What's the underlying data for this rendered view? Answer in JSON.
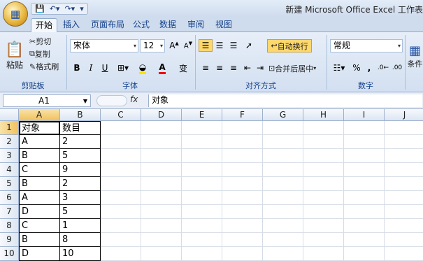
{
  "window": {
    "title": "新建 Microsoft Office Excel 工作表"
  },
  "qat": {
    "items": [
      "save-icon",
      "undo-icon",
      "redo-icon",
      "customize-icon"
    ]
  },
  "tabs": [
    "开始",
    "插入",
    "页面布局",
    "公式",
    "数据",
    "审阅",
    "视图"
  ],
  "ribbon": {
    "clipboard": {
      "paste": "粘贴",
      "cut": "剪切",
      "copy": "复制",
      "format_painter": "格式刷",
      "label": "剪贴板"
    },
    "font": {
      "name": "宋体",
      "size": "12",
      "label": "字体",
      "bold": "B",
      "italic": "I",
      "underline": "U",
      "phonetic": "变"
    },
    "alignment": {
      "wrap": "自动换行",
      "merge": "合并后居中",
      "label": "对齐方式"
    },
    "number": {
      "format": "常规",
      "percent": "%",
      "comma": ",",
      "label": "数字"
    },
    "styles": {
      "cond_fmt": "条件"
    }
  },
  "formula_bar": {
    "name_box": "A1",
    "fx": "fx",
    "content": "对象"
  },
  "grid": {
    "columns": [
      "A",
      "B",
      "C",
      "D",
      "E",
      "F",
      "G",
      "H",
      "I",
      "J"
    ],
    "rows": [
      "1",
      "2",
      "3",
      "4",
      "5",
      "6",
      "7",
      "8",
      "9",
      "10"
    ],
    "cells": [
      [
        "对象",
        "数目"
      ],
      [
        "A",
        "2"
      ],
      [
        "B",
        "5"
      ],
      [
        "C",
        "9"
      ],
      [
        "B",
        "2"
      ],
      [
        "A",
        "3"
      ],
      [
        "D",
        "5"
      ],
      [
        "C",
        "1"
      ],
      [
        "B",
        "8"
      ],
      [
        "D",
        "10"
      ]
    ]
  }
}
